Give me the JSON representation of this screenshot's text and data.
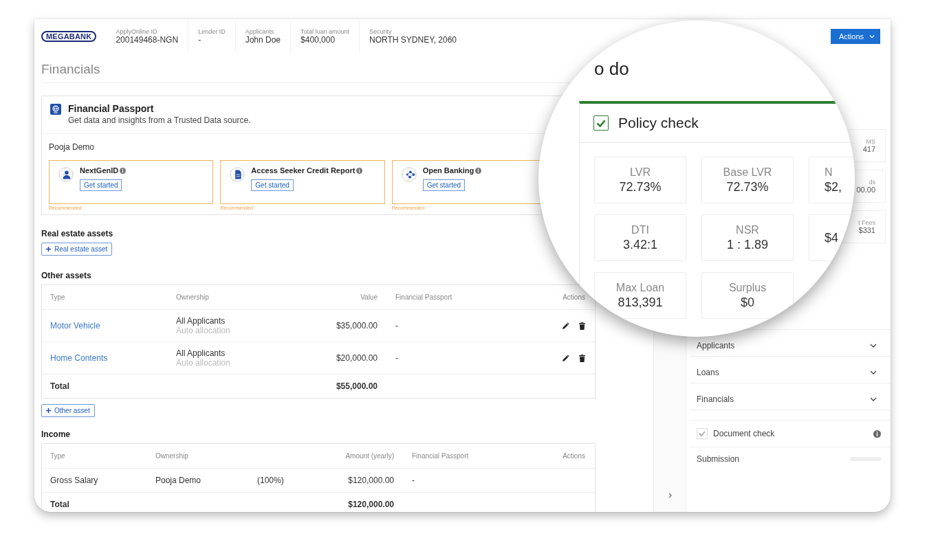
{
  "header": {
    "logo": "MEGABANK",
    "fields": [
      {
        "label": "ApplyOnline ID",
        "value": "200149468-NGN"
      },
      {
        "label": "Lender ID",
        "value": "-"
      },
      {
        "label": "Applicants",
        "value": "John Doe"
      },
      {
        "label": "Total loan amount",
        "value": "$400,000"
      },
      {
        "label": "Security",
        "value": "NORTH SYDNEY, 2060"
      }
    ],
    "actions_button": "Actions"
  },
  "page_title": "Financials",
  "passport": {
    "title": "Financial Passport",
    "subtitle": "Get data and insights from a Trusted Data source.",
    "applicant": "Pooja Demo",
    "options": [
      {
        "kind": "identity",
        "title": "NextGenID",
        "button": "Get started",
        "note": "Recommended"
      },
      {
        "kind": "credit",
        "title": "Access Seeker Credit Report",
        "button": "Get started",
        "note": "Recommended"
      },
      {
        "kind": "banking",
        "title": "Open Banking",
        "button": "Get started",
        "note": "Recommended"
      }
    ]
  },
  "real_estate": {
    "heading": "Real estate assets",
    "add_button": "Real estate asset"
  },
  "other_assets": {
    "heading": "Other assets",
    "columns": [
      "Type",
      "Ownership",
      "Value",
      "Financial Passport",
      "Actions"
    ],
    "rows": [
      {
        "type": "Motor Vehicle",
        "ownership": "All Applicants",
        "allocation": "Auto allocation",
        "value": "$35,000.00",
        "passport": "-"
      },
      {
        "type": "Home Contents",
        "ownership": "All Applicants",
        "allocation": "Auto allocation",
        "value": "$20,000.00",
        "passport": "-"
      }
    ],
    "total": {
      "label": "Total",
      "value": "$55,000.00"
    },
    "add_button": "Other asset"
  },
  "income": {
    "heading": "Income",
    "columns": [
      "Type",
      "Ownership",
      "Amount (yearly)",
      "Financial Passport",
      "Actions"
    ],
    "rows": [
      {
        "type": "Gross Salary",
        "ownership": "Pooja Demo",
        "share": "(100%)",
        "amount": "$120,000.00",
        "passport": "-"
      }
    ],
    "total": {
      "label": "Total",
      "value": "$120,000.00"
    }
  },
  "todo": {
    "title": "o do",
    "policy_check": {
      "title": "Policy check",
      "checked": true,
      "metrics": [
        {
          "label": "LVR",
          "value": "72.73%"
        },
        {
          "label": "Base LVR",
          "value": "72.73%"
        },
        {
          "label": "N",
          "value": "$2,"
        },
        {
          "label": "DTI",
          "value": "3.42:1"
        },
        {
          "label": "NSR",
          "value": "1 : 1.89"
        },
        {
          "value": "$4"
        },
        {
          "label": "Max Loan",
          "value": "813,391"
        },
        {
          "label": "Surplus",
          "value": "$0"
        }
      ]
    }
  },
  "right_panel": {
    "summary_fragments": [
      {
        "label": "MS",
        "value": "417"
      },
      {
        "label": "ds",
        "value": "00.00"
      },
      {
        "label": "t Fees",
        "value": "$331"
      }
    ],
    "sections": [
      {
        "title": "Applicants",
        "expanded": false
      },
      {
        "title": "Loans",
        "expanded": false
      },
      {
        "title": "Financials",
        "expanded": false
      }
    ],
    "document_check": {
      "label": "Document check",
      "checked": true,
      "disabled": true
    },
    "submission": "Submission"
  }
}
